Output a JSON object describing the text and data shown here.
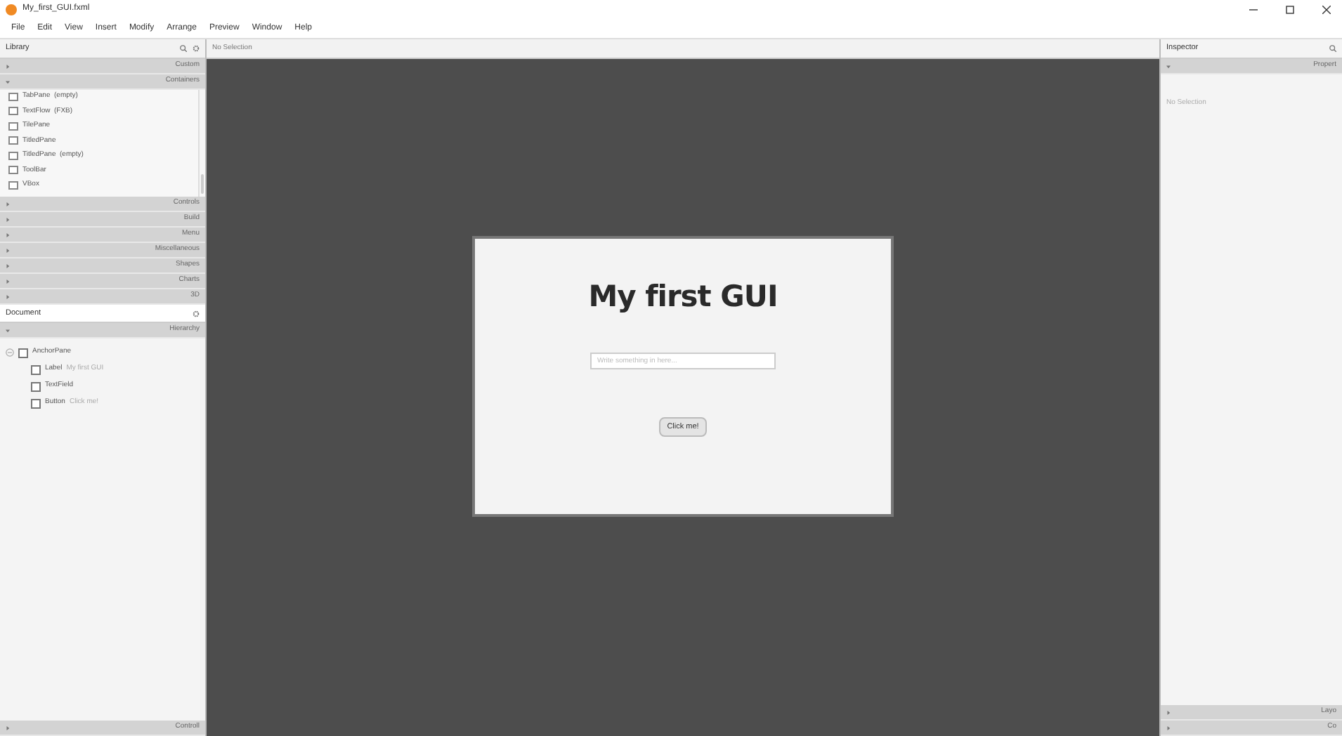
{
  "window": {
    "title": "My_first_GUI.fxml"
  },
  "menu": [
    "File",
    "Edit",
    "View",
    "Insert",
    "Modify",
    "Arrange",
    "Preview",
    "Window",
    "Help"
  ],
  "library": {
    "title": "Library",
    "sections": [
      {
        "label": "Custom",
        "expanded": false
      },
      {
        "label": "Containers",
        "expanded": true,
        "items": [
          "TabPane  (empty)",
          "TextFlow  (FXB)",
          "TilePane",
          "TitledPane",
          "TitledPane  (empty)",
          "ToolBar",
          "VBox"
        ]
      },
      {
        "label": "Controls",
        "expanded": false
      },
      {
        "label": "Build",
        "expanded": false
      },
      {
        "label": "Menu",
        "expanded": false
      },
      {
        "label": "Miscellaneous",
        "expanded": false
      },
      {
        "label": "Shapes",
        "expanded": false
      },
      {
        "label": "Charts",
        "expanded": false
      },
      {
        "label": "3D",
        "expanded": false
      }
    ]
  },
  "document": {
    "title": "Document",
    "hierarchy": {
      "label": "Hierarchy",
      "expanded": true
    },
    "tree": [
      {
        "name": "AnchorPane",
        "expanded": true,
        "children": [
          {
            "name": "Label",
            "detail": "My first GUI"
          },
          {
            "name": "TextField"
          },
          {
            "name": "Button",
            "detail": "Click me!"
          }
        ]
      }
    ],
    "controller": {
      "label": "Controll",
      "expanded": false
    }
  },
  "canvas": {
    "status": "No Selection",
    "label": "My first GUI",
    "field": {
      "placeholder": "Write something in here..."
    },
    "button": "Click me!"
  },
  "inspector": {
    "title": "Inspector",
    "sections": [
      {
        "label": "Propert",
        "expanded": true,
        "content": "No Selection"
      },
      {
        "label": "Layo",
        "expanded": false
      },
      {
        "label": "Co",
        "expanded": false
      }
    ]
  }
}
